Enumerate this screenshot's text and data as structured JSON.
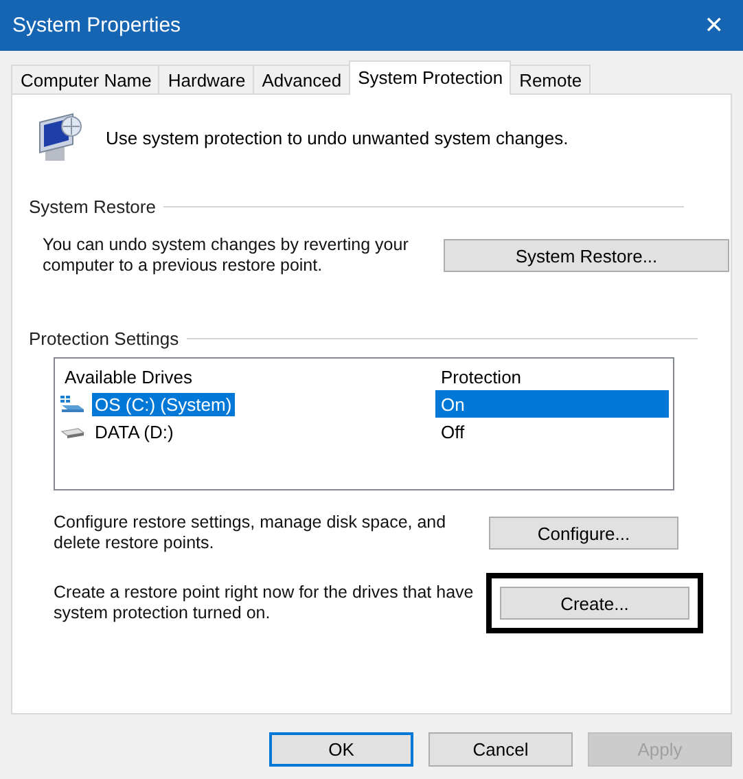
{
  "window": {
    "title": "System Properties",
    "close": "✕"
  },
  "tabs": [
    {
      "label": "Computer Name",
      "selected": false
    },
    {
      "label": "Hardware",
      "selected": false
    },
    {
      "label": "Advanced",
      "selected": false
    },
    {
      "label": "System Protection",
      "selected": true
    },
    {
      "label": "Remote",
      "selected": false
    }
  ],
  "intro": "Use system protection to undo unwanted system changes.",
  "system_restore": {
    "heading": "System Restore",
    "text": "You can undo system changes by reverting your computer to a previous restore point.",
    "button": "System Restore..."
  },
  "protection_settings": {
    "heading": "Protection Settings",
    "columns": [
      "Available Drives",
      "Protection"
    ],
    "drives": [
      {
        "name": "OS (C:) (System)",
        "protection": "On",
        "kind": "system",
        "selected": true
      },
      {
        "name": "DATA (D:)",
        "protection": "Off",
        "kind": "data",
        "selected": false
      }
    ],
    "configure": {
      "text": "Configure restore settings, manage disk space, and delete restore points.",
      "button": "Configure..."
    },
    "create": {
      "text": "Create a restore point right now for the drives that have system protection turned on.",
      "button": "Create...",
      "highlighted": true
    }
  },
  "buttons": [
    {
      "label": "OK",
      "default": true,
      "disabled": false
    },
    {
      "label": "Cancel",
      "default": false,
      "disabled": false
    },
    {
      "label": "Apply",
      "default": false,
      "disabled": true
    }
  ]
}
